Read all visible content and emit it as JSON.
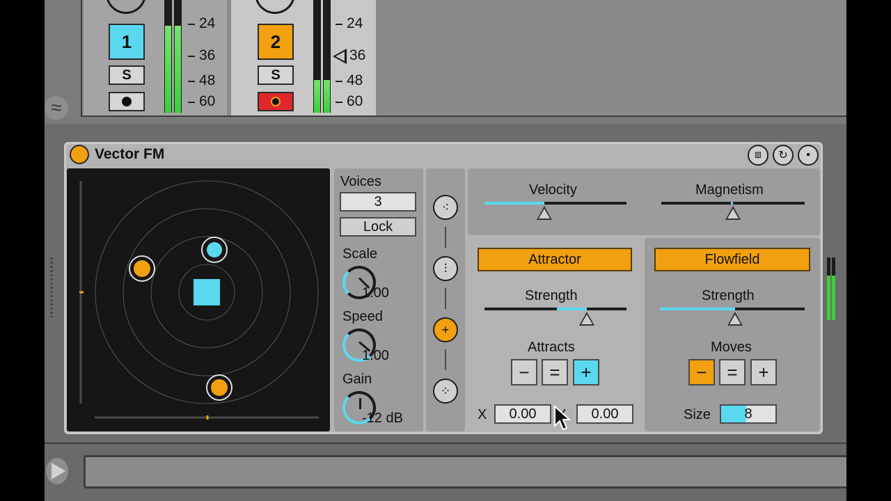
{
  "tracks": [
    {
      "number": "1",
      "solo": "S",
      "color": "#5ad8f0",
      "meter_level": 0.77,
      "scale": [
        "24",
        "36",
        "48",
        "60"
      ]
    },
    {
      "number": "2",
      "solo": "S",
      "color": "#f2a00f",
      "meter_level": 0.29,
      "scale": [
        "24",
        "36",
        "48",
        "60"
      ]
    }
  ],
  "device": {
    "title": "Vector FM",
    "voices_label": "Voices",
    "voices_value": "3",
    "lock_label": "Lock",
    "scale_label": "Scale",
    "scale_value": "1.00",
    "speed_label": "Speed",
    "speed_value": "1.00",
    "gain_label": "Gain",
    "gain_value": "-12 dB",
    "velocity_label": "Velocity",
    "velocity_level": 0.42,
    "magnetism_label": "Magnetism",
    "magnetism_level": 0.5,
    "attractor": {
      "title": "Attractor",
      "strength_label": "Strength",
      "strength_level": 0.72,
      "attracts_label": "Attracts",
      "buttons": [
        "−",
        "=",
        "+"
      ],
      "x_label": "X",
      "x_value": "0.00",
      "y_label": "Y",
      "y_value": "0.00"
    },
    "flowfield": {
      "title": "Flowfield",
      "strength_label": "Strength",
      "strength_level": 0.52,
      "moves_label": "Moves",
      "buttons": [
        "−",
        "=",
        "+"
      ],
      "size_label": "Size",
      "size_value": "8"
    }
  },
  "colors": {
    "accent_blue": "#5ad8f0",
    "accent_orange": "#f2a00f",
    "record_red": "#e0282a"
  }
}
